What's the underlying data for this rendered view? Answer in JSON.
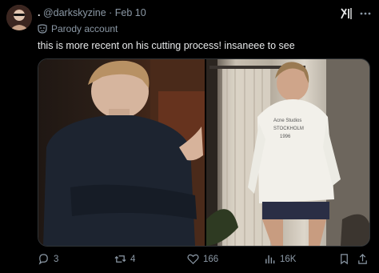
{
  "post": {
    "display_name": ".",
    "handle": "@darkskyzine",
    "separator": "·",
    "date": "Feb 10",
    "parody_label": "Parody account",
    "text": "this is more recent on his cutting process! insaneee to see",
    "shirt_text": [
      "Acne Studios",
      "STOCKHOLM",
      "1996"
    ]
  },
  "icons": {
    "avatar": "avatar-image",
    "parody": "mask-icon",
    "grok": "grok-icon",
    "more": "more-icon",
    "reply": "reply-icon",
    "repost": "repost-icon",
    "like": "heart-icon",
    "views": "views-icon",
    "bookmark": "bookmark-icon",
    "share": "share-icon"
  },
  "actions": {
    "replies": "3",
    "reposts": "4",
    "likes": "166",
    "views": "16K"
  },
  "colors": {
    "background": "#000000",
    "text": "#e7e9ea",
    "muted": "#8b98a5",
    "border": "#2f3336"
  }
}
